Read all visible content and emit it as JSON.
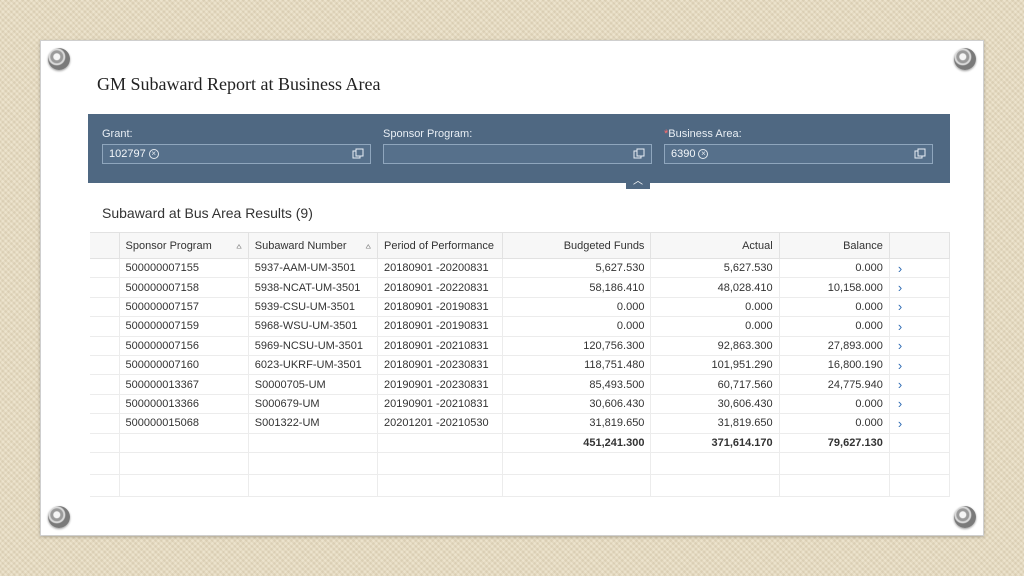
{
  "slide": {
    "title": "GM Subaward Report at Business Area"
  },
  "filters": {
    "grant": {
      "label": "Grant:",
      "token": "102797"
    },
    "sponsor_program": {
      "label": "Sponsor Program:",
      "token": ""
    },
    "business_area": {
      "required_mark": "*",
      "label": "Business Area:",
      "token": "6390"
    }
  },
  "results": {
    "title": "Subaward at Bus Area Results (9)",
    "columns": [
      "Sponsor Program",
      "Subaward Number",
      "Period of Performance",
      "Budgeted Funds",
      "Actual",
      "Balance"
    ],
    "rows": [
      [
        "500000007155",
        "5937-AAM-UM-3501",
        "20180901 -20200831",
        "5,627.530",
        "5,627.530",
        "0.000"
      ],
      [
        "500000007158",
        "5938-NCAT-UM-3501",
        "20180901 -20220831",
        "58,186.410",
        "48,028.410",
        "10,158.000"
      ],
      [
        "500000007157",
        "5939-CSU-UM-3501",
        "20180901 -20190831",
        "0.000",
        "0.000",
        "0.000"
      ],
      [
        "500000007159",
        "5968-WSU-UM-3501",
        "20180901 -20190831",
        "0.000",
        "0.000",
        "0.000"
      ],
      [
        "500000007156",
        "5969-NCSU-UM-3501",
        "20180901 -20210831",
        "120,756.300",
        "92,863.300",
        "27,893.000"
      ],
      [
        "500000007160",
        "6023-UKRF-UM-3501",
        "20180901 -20230831",
        "118,751.480",
        "101,951.290",
        "16,800.190"
      ],
      [
        "500000013367",
        "S0000705-UM",
        "20190901 -20230831",
        "85,493.500",
        "60,717.560",
        "24,775.940"
      ],
      [
        "500000013366",
        "S000679-UM",
        "20190901 -20210831",
        "30,606.430",
        "30,606.430",
        "0.000"
      ],
      [
        "500000015068",
        "S001322-UM",
        "20201201 -20210530",
        "31,819.650",
        "31,819.650",
        "0.000"
      ]
    ],
    "totals": {
      "budgeted": "451,241.300",
      "actual": "371,614.170",
      "balance": "79,627.130"
    }
  },
  "colors": {
    "filter_bar": "#4f6882",
    "nav_arrow": "#2f6bb3"
  }
}
